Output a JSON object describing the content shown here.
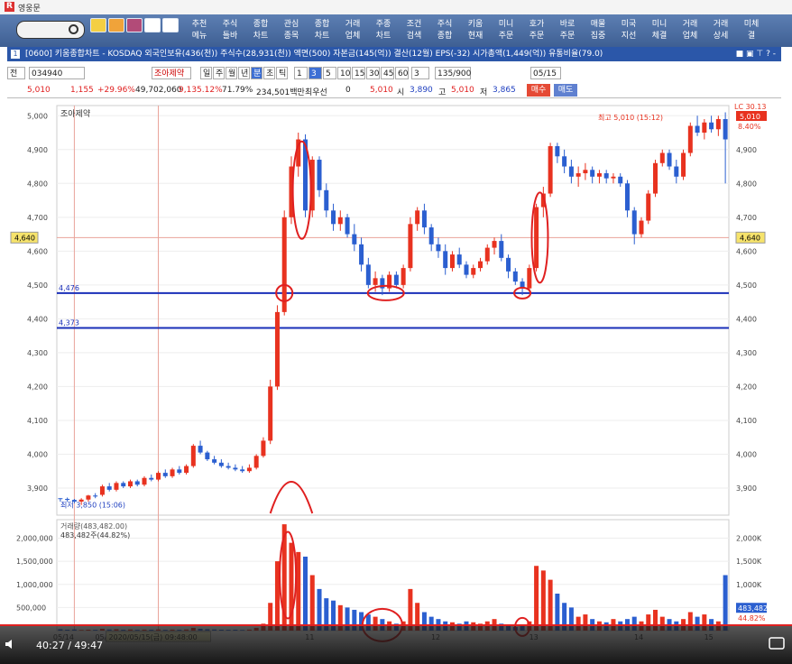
{
  "app": {
    "title": "영웅문",
    "window_title": "[0600] 키움종합차트 - KOSDAQ 외국인보유(436(천)) 주식수(28,931(천)) 액면(500) 자본금(145(억)) 결산(12월) EPS(-32) 시가총액(1,449(억)) 유통비율(79.0)",
    "window_number": "1",
    "window_controls": "■ ▣ ⊤ ? -"
  },
  "toolbar": {
    "buttons": [
      {
        "l1": "추천",
        "l2": "메뉴"
      },
      {
        "l1": "주식",
        "l2": "틀바"
      },
      {
        "l1": "종합",
        "l2": "차트"
      },
      {
        "l1": "관심",
        "l2": "종목"
      },
      {
        "l1": "종합",
        "l2": "차트"
      },
      {
        "l1": "거래",
        "l2": "업체"
      },
      {
        "l1": "주종",
        "l2": "차트"
      },
      {
        "l1": "조건",
        "l2": "검색"
      },
      {
        "l1": "주식",
        "l2": "종합"
      },
      {
        "l1": "키움",
        "l2": "현재"
      },
      {
        "l1": "미니",
        "l2": "주문"
      },
      {
        "l1": "호가",
        "l2": "주문"
      },
      {
        "l1": "바로",
        "l2": "주문"
      },
      {
        "l1": "매물",
        "l2": "집중"
      },
      {
        "l1": "미국",
        "l2": "지선"
      },
      {
        "l1": "미니",
        "l2": "체결"
      },
      {
        "l1": "거래",
        "l2": "업체"
      },
      {
        "l1": "거래",
        "l2": "상세"
      },
      {
        "l1": "미체",
        "l2": "결"
      }
    ],
    "icons": [
      "notepad-icon",
      "pencil-icon",
      "monitor-icon",
      "chevron-icon",
      "gear-icon"
    ]
  },
  "controls": {
    "market": "전",
    "code": "034940",
    "name": "조아제약",
    "periods": [
      "일",
      "주",
      "월",
      "년",
      "분",
      "초",
      "틱"
    ],
    "selected_period": "분",
    "intervals": [
      "1",
      "3",
      "5",
      "10",
      "15",
      "30",
      "45",
      "60"
    ],
    "selected_interval": "3",
    "range_select": "3",
    "count": "135/900",
    "date": "05/15"
  },
  "quote": {
    "price": "5,010",
    "change": "1,155",
    "change_pct": "+29.96%",
    "volume": "49,702,060",
    "trade_value": "9,135.12%",
    "rate": "71.79%",
    "amount": "234,501백만",
    "hoga_label": "최우선",
    "zero": "0",
    "open_price": "5,010",
    "open_label": "시",
    "open": "3,890",
    "high_label": "고",
    "high": "5,010",
    "low_label": "저",
    "low": "3,865",
    "buy": "매수",
    "sell": "매도"
  },
  "chart_data": {
    "type": "candlestick",
    "title": "조아제약",
    "ylim": [
      3820,
      5030
    ],
    "y_ticks": [
      3900,
      4000,
      4100,
      4200,
      4300,
      4400,
      4500,
      4600,
      4700,
      4800,
      4900,
      5000
    ],
    "y_tick_labels": [
      "3,900",
      "4,000",
      "4,100",
      "4,200",
      "4,300",
      "4,400",
      "4,500",
      "4,600",
      "4,700",
      "4,800",
      "4,900",
      "5,000"
    ],
    "x_labels": [
      "05/14",
      "05/15",
      "11",
      "12",
      "13",
      "14",
      "15"
    ],
    "cursor_label": "2020/05/15(금) 09:48:00",
    "cursor_price": "4,640",
    "levels": [
      {
        "value": 4476,
        "label": "4,476"
      },
      {
        "value": 4373,
        "label": "4,373"
      }
    ],
    "annotations": {
      "high": "최고 5,010 (15:12)",
      "low": "최저 3,850 (15:06)",
      "last_price": "5,010",
      "last_change": "8.40%",
      "last_ref": "LC 30.13"
    },
    "candles": [
      [
        3870,
        3870,
        3860,
        3868
      ],
      [
        3868,
        3872,
        3860,
        3865
      ],
      [
        3865,
        3868,
        3855,
        3860
      ],
      [
        3860,
        3870,
        3850,
        3866
      ],
      [
        3866,
        3880,
        3860,
        3878
      ],
      [
        3878,
        3885,
        3870,
        3875
      ],
      [
        3880,
        3910,
        3875,
        3905
      ],
      [
        3905,
        3915,
        3890,
        3895
      ],
      [
        3895,
        3920,
        3890,
        3915
      ],
      [
        3915,
        3920,
        3900,
        3905
      ],
      [
        3905,
        3925,
        3900,
        3920
      ],
      [
        3920,
        3925,
        3905,
        3910
      ],
      [
        3910,
        3935,
        3905,
        3930
      ],
      [
        3930,
        3940,
        3920,
        3925
      ],
      [
        3925,
        3950,
        3920,
        3945
      ],
      [
        3945,
        3955,
        3930,
        3935
      ],
      [
        3935,
        3960,
        3930,
        3955
      ],
      [
        3955,
        3965,
        3940,
        3945
      ],
      [
        3945,
        3970,
        3940,
        3965
      ],
      [
        3965,
        4030,
        3960,
        4025
      ],
      [
        4025,
        4040,
        4000,
        4005
      ],
      [
        4005,
        4010,
        3980,
        3985
      ],
      [
        3985,
        3995,
        3970,
        3975
      ],
      [
        3975,
        3985,
        3960,
        3965
      ],
      [
        3965,
        3975,
        3955,
        3960
      ],
      [
        3960,
        3970,
        3950,
        3955
      ],
      [
        3955,
        3965,
        3945,
        3950
      ],
      [
        3950,
        3970,
        3945,
        3960
      ],
      [
        3960,
        4000,
        3955,
        3995
      ],
      [
        3995,
        4050,
        3990,
        4040
      ],
      [
        4040,
        4220,
        4030,
        4200
      ],
      [
        4200,
        4440,
        4190,
        4420
      ],
      [
        4420,
        4720,
        4410,
        4700
      ],
      [
        4700,
        4880,
        4680,
        4850
      ],
      [
        4850,
        4950,
        4820,
        4930
      ],
      [
        4930,
        4945,
        4700,
        4720
      ],
      [
        4720,
        4880,
        4700,
        4870
      ],
      [
        4870,
        4880,
        4760,
        4780
      ],
      [
        4780,
        4800,
        4700,
        4720
      ],
      [
        4720,
        4740,
        4660,
        4680
      ],
      [
        4680,
        4720,
        4660,
        4700
      ],
      [
        4700,
        4710,
        4640,
        4650
      ],
      [
        4650,
        4680,
        4600,
        4620
      ],
      [
        4620,
        4640,
        4540,
        4560
      ],
      [
        4560,
        4580,
        4490,
        4500
      ],
      [
        4500,
        4540,
        4480,
        4520
      ],
      [
        4520,
        4530,
        4470,
        4490
      ],
      [
        4490,
        4540,
        4480,
        4530
      ],
      [
        4530,
        4540,
        4490,
        4500
      ],
      [
        4500,
        4560,
        4490,
        4550
      ],
      [
        4550,
        4700,
        4540,
        4680
      ],
      [
        4680,
        4730,
        4660,
        4720
      ],
      [
        4720,
        4740,
        4650,
        4670
      ],
      [
        4670,
        4680,
        4600,
        4620
      ],
      [
        4620,
        4640,
        4580,
        4600
      ],
      [
        4600,
        4620,
        4530,
        4550
      ],
      [
        4550,
        4600,
        4540,
        4590
      ],
      [
        4590,
        4610,
        4550,
        4560
      ],
      [
        4560,
        4570,
        4520,
        4530
      ],
      [
        4530,
        4560,
        4520,
        4550
      ],
      [
        4550,
        4580,
        4540,
        4570
      ],
      [
        4570,
        4620,
        4560,
        4610
      ],
      [
        4610,
        4640,
        4590,
        4630
      ],
      [
        4630,
        4650,
        4570,
        4580
      ],
      [
        4580,
        4590,
        4520,
        4540
      ],
      [
        4540,
        4550,
        4500,
        4510
      ],
      [
        4510,
        4520,
        4470,
        4490
      ],
      [
        4490,
        4560,
        4480,
        4550
      ],
      [
        4550,
        4740,
        4540,
        4730
      ],
      [
        4730,
        4790,
        4700,
        4770
      ],
      [
        4770,
        4920,
        4760,
        4910
      ],
      [
        4910,
        4920,
        4860,
        4880
      ],
      [
        4880,
        4900,
        4830,
        4850
      ],
      [
        4850,
        4870,
        4800,
        4820
      ],
      [
        4820,
        4850,
        4790,
        4830
      ],
      [
        4830,
        4860,
        4810,
        4840
      ],
      [
        4840,
        4850,
        4800,
        4820
      ],
      [
        4820,
        4840,
        4800,
        4830
      ],
      [
        4830,
        4840,
        4800,
        4815
      ],
      [
        4815,
        4830,
        4800,
        4820
      ],
      [
        4820,
        4830,
        4790,
        4800
      ],
      [
        4800,
        4810,
        4700,
        4720
      ],
      [
        4720,
        4730,
        4620,
        4650
      ],
      [
        4650,
        4700,
        4640,
        4690
      ],
      [
        4690,
        4780,
        4680,
        4770
      ],
      [
        4770,
        4870,
        4760,
        4860
      ],
      [
        4860,
        4900,
        4850,
        4890
      ],
      [
        4890,
        4900,
        4840,
        4850
      ],
      [
        4850,
        4870,
        4800,
        4820
      ],
      [
        4820,
        4900,
        4810,
        4890
      ],
      [
        4890,
        4980,
        4880,
        4970
      ],
      [
        4970,
        5000,
        4940,
        4950
      ],
      [
        4950,
        4990,
        4930,
        4980
      ],
      [
        4980,
        5000,
        4950,
        4960
      ],
      [
        4960,
        5000,
        4940,
        4990
      ],
      [
        4990,
        5010,
        4800,
        4930
      ]
    ],
    "volume": {
      "label": "거래량(483,482.00)",
      "sub_label": "483,482주(44.82%)",
      "ylim": [
        0,
        2400000
      ],
      "y_ticks": [
        500000,
        1000000,
        1500000,
        2000000
      ],
      "y_tick_labels": [
        "500,000",
        "1,000,000",
        "1,500,000",
        "2,000,000"
      ],
      "y_tick_labels_right": [
        "500,000",
        "1,000K",
        "1,500K",
        "2,000K"
      ],
      "last_label": "483,482",
      "last_pct": "44.82%",
      "values": [
        30000,
        20000,
        25000,
        15000,
        20000,
        18000,
        40000,
        25000,
        30000,
        20000,
        25000,
        18000,
        22000,
        20000,
        25000,
        18000,
        22000,
        20000,
        25000,
        60000,
        40000,
        30000,
        25000,
        20000,
        18000,
        20000,
        15000,
        22000,
        60000,
        150000,
        600000,
        1500000,
        2300000,
        1900000,
        1700000,
        1600000,
        1200000,
        900000,
        700000,
        650000,
        550000,
        500000,
        450000,
        400000,
        350000,
        300000,
        250000,
        200000,
        150000,
        200000,
        900000,
        600000,
        400000,
        300000,
        250000,
        200000,
        180000,
        150000,
        200000,
        180000,
        150000,
        200000,
        250000,
        150000,
        100000,
        80000,
        120000,
        200000,
        1400000,
        1300000,
        1100000,
        800000,
        600000,
        500000,
        300000,
        350000,
        250000,
        200000,
        180000,
        250000,
        200000,
        250000,
        300000,
        200000,
        350000,
        450000,
        300000,
        250000,
        200000,
        250000,
        400000,
        300000,
        350000,
        250000,
        200000,
        1200000
      ]
    },
    "colors": {
      "up": "#e8321f",
      "down": "#2b5fd0",
      "level": "#1a2fb8",
      "marker": "#e02020",
      "cursor": "#e9a39a"
    }
  },
  "player": {
    "time": "40:27 / 49:47"
  }
}
